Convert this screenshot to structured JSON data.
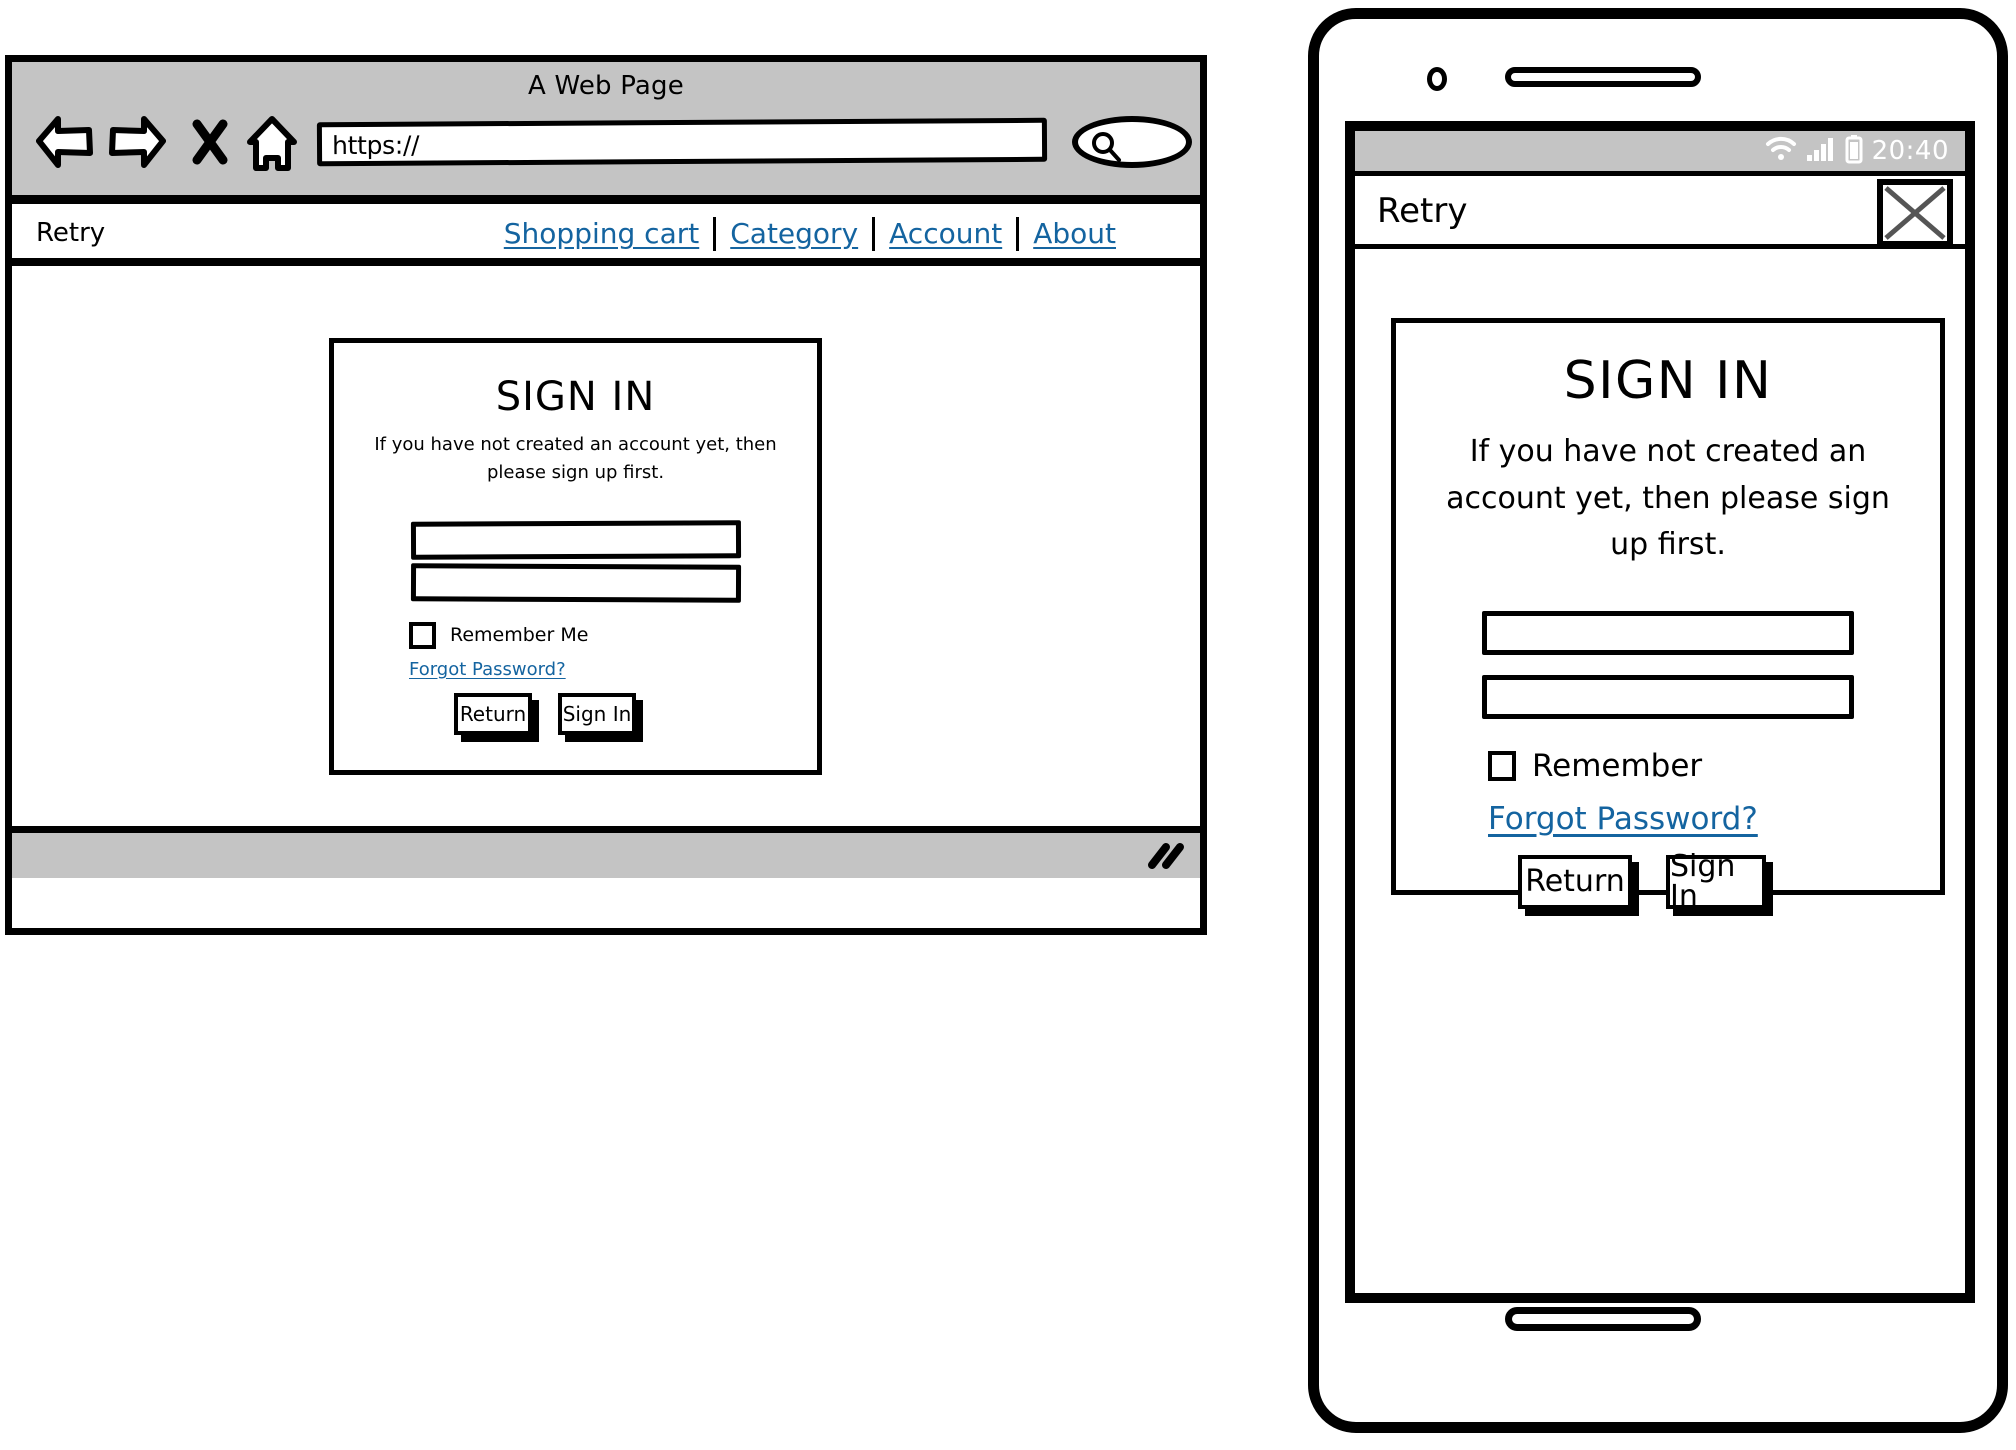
{
  "desktop": {
    "window_title": "A Web Page",
    "toolbar": {
      "back_icon": "back-arrow-icon",
      "forward_icon": "forward-arrow-icon",
      "stop_icon": "stop-x-icon",
      "home_icon": "home-icon",
      "search_icon": "magnifier-icon",
      "url_value": "https://",
      "url_placeholder": "https://"
    },
    "site_nav": {
      "brand": "Retry",
      "links": [
        {
          "label": "Shopping cart"
        },
        {
          "label": "Category"
        },
        {
          "label": "Account"
        },
        {
          "label": "About"
        }
      ]
    },
    "signin_card": {
      "title": "SIGN IN",
      "subtitle": "If you have not created an account yet, then please sign up first.",
      "username_value": "",
      "username_placeholder": "",
      "password_value": "",
      "password_placeholder": "",
      "remember_label": "Remember Me",
      "remember_checked": false,
      "forgot_label": "Forgot Password?",
      "return_label": "Return",
      "signin_label": "Sign In"
    },
    "footer": {
      "resize_grip_icon": "resize-grip-icon"
    }
  },
  "mobile": {
    "status_bar": {
      "wifi_icon": "wifi-icon",
      "signal_icon": "cellular-signal-icon",
      "battery_icon": "battery-icon",
      "time": "20:40"
    },
    "app_bar": {
      "title": "Retry",
      "action_icon": "close-x-icon"
    },
    "signin_card": {
      "title": "SIGN IN",
      "subtitle": "If you have not created an account yet, then please sign up first.",
      "username_value": "",
      "username_placeholder": "",
      "password_value": "",
      "password_placeholder": "",
      "remember_label": "Remember",
      "remember_checked": false,
      "forgot_label": "Forgot Password?",
      "return_label": "Return",
      "signin_label": "Sign In"
    },
    "hardware": {
      "camera_icon": "front-camera-icon",
      "speaker_icon": "earpiece-speaker-icon",
      "home_button_icon": "home-button-icon"
    }
  },
  "colors": {
    "link": "#1464a0",
    "chrome_gray": "#c4c4c4",
    "ink": "#000000",
    "status_text": "#ffffff"
  }
}
